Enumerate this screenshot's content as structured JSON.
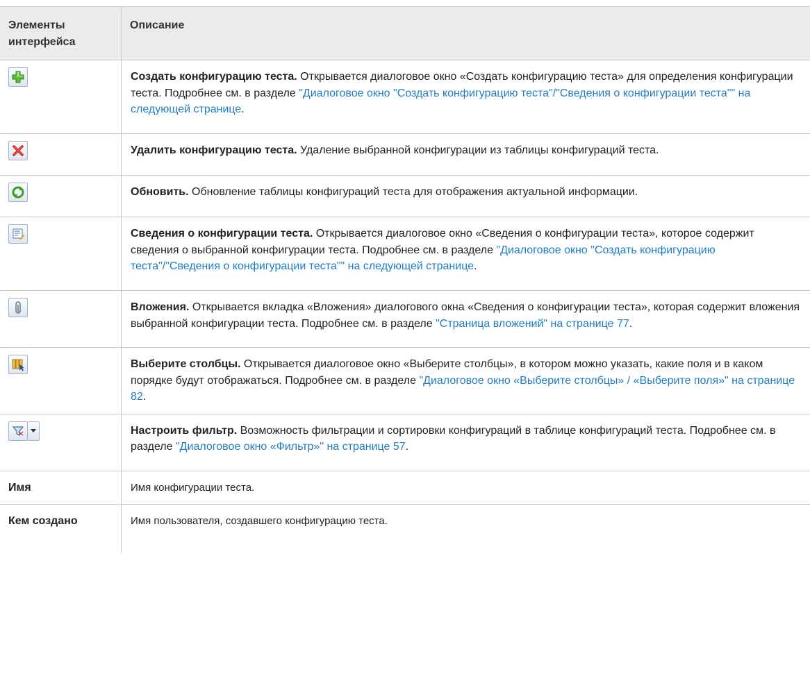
{
  "header": {
    "col1": "Элементы интерфейса",
    "col2": "Описание"
  },
  "rows": [
    {
      "icon": "add-config-icon",
      "title": "Создать конфигурацию теста.",
      "text": " Открывается диалоговое окно «Создать конфигурацию теста» для определения конфигурации теста. Подробнее см. в разделе ",
      "link": "\"Диалоговое окно \"Создать конфигурацию теста\"/\"Сведения о конфигурации теста\"\" на следующей странице",
      "after": "."
    },
    {
      "icon": "delete-config-icon",
      "title": "Удалить конфигурацию теста.",
      "text": " Удаление выбранной конфигурации из таблицы конфигураций теста.",
      "link": "",
      "after": ""
    },
    {
      "icon": "refresh-icon",
      "title": "Обновить.",
      "text": " Обновление таблицы конфигураций теста для отображения актуальной информации.",
      "link": "",
      "after": ""
    },
    {
      "icon": "config-details-icon",
      "title": "Сведения о конфигурации теста.",
      "text": " Открывается диалоговое окно «Сведения о конфигурации теста», которое содержит сведения о выбранной конфигурации теста. Подробнее см. в разделе ",
      "link": "\"Диалоговое окно \"Создать конфигурацию теста\"/\"Сведения о конфигурации теста\"\" на следующей странице",
      "after": "."
    },
    {
      "icon": "attachment-icon",
      "title": "Вложения.",
      "text": " Открывается вкладка «Вложения» диалогового окна «Сведения о конфигурации теста», которая содержит вложения выбранной конфигурации теста. Подробнее см. в разделе ",
      "link": "\"Страница вложений\" на странице 77",
      "after": "."
    },
    {
      "icon": "select-columns-icon",
      "title": "Выберите столбцы.",
      "text": " Открывается диалоговое окно «Выберите столбцы», в котором можно указать, какие поля и в каком порядке будут отображаться. Подробнее см. в разделе ",
      "link": "\"Диалоговое окно «Выберите столбцы» / «Выберите поля»\" на странице 82",
      "after": "."
    },
    {
      "icon": "filter-icon",
      "title": "Настроить фильтр.",
      "text": " Возможность фильтрации и сортировки конфигураций в таблице конфигураций теста. Подробнее см. в разделе ",
      "link": "\"Диалоговое окно «Фильтр»\" на странице 57",
      "after": "."
    }
  ],
  "fields": [
    {
      "term": "Имя",
      "desc": "Имя конфигурации теста."
    },
    {
      "term": "Кем создано",
      "desc": "Имя пользователя, создавшего конфигурацию теста."
    }
  ]
}
